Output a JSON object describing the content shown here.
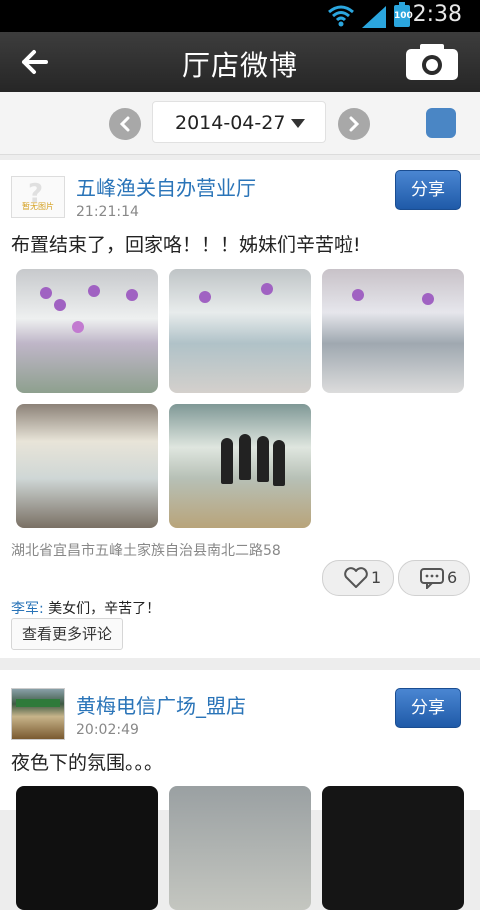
{
  "status_bar": {
    "time": "2:38",
    "battery": "100"
  },
  "header": {
    "title": "厅店微博"
  },
  "date_bar": {
    "date": "2014-04-27"
  },
  "posts": [
    {
      "shop": "五峰渔关自办营业厅",
      "time": "21:21:14",
      "share_label": "分享",
      "text": "布置结束了，回家咯！！！姊妹们辛苦啦!",
      "avatar_caption": "暂无图片",
      "location": "湖北省宜昌市五峰土家族自治县南北二路58",
      "likes": "1",
      "comments": "6",
      "comment": {
        "author": "李军:",
        "text": " 美女们，辛苦了！"
      },
      "more_comments": "查看更多评论"
    },
    {
      "shop": "黄梅电信广场_盟店",
      "time": "20:02:49",
      "share_label": "分享",
      "text": "夜色下的氛围。。。"
    }
  ],
  "icons": {
    "back": "back-arrow-icon",
    "camera": "camera-icon",
    "prev": "chevron-left-icon",
    "next": "chevron-right-icon",
    "like": "heart-icon",
    "comment": "comment-icon"
  },
  "colors": {
    "accent_blue": "#2a74b8",
    "share_button": "#2f6cc0",
    "title_bar": "#2e2e2e"
  }
}
